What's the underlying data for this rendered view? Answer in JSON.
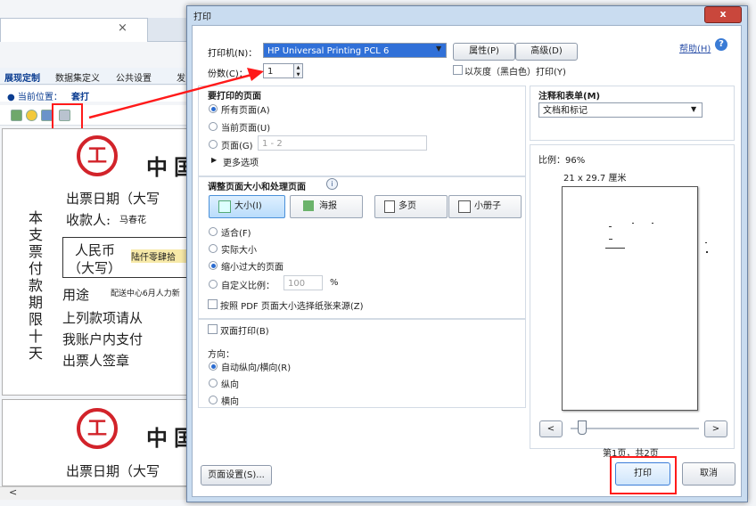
{
  "background_app": {
    "tab_close_glyph": "×",
    "menu": [
      "展现定制",
      "数据集定义",
      "公共设置",
      "发"
    ],
    "location_label": "● 当前位置：",
    "location_value": "套打",
    "cheque": {
      "logo_glyph": "工",
      "bank_char1": "中",
      "bank_char2": "国",
      "vertical_text": [
        "本",
        "支",
        "票",
        "付",
        "款",
        "期",
        "限",
        "十",
        "天"
      ],
      "issue_date": "出票日期（大写",
      "payee_label": "收款人:",
      "payee_value": "马春花",
      "rmb_label": "人民币",
      "rmb_sub": "（大写）",
      "amount_value": "陆仟零肆拾",
      "purpose_label": "用途",
      "purpose_value": "配送中心6月人力新",
      "line1": "上列款项请从",
      "line2": "我账户内支付",
      "line3": "出票人签章"
    },
    "scroll_left": "<"
  },
  "dialog": {
    "title": "打印",
    "close_glyph": "x",
    "printer_label": "打印机(N)：",
    "printer_value": "HP Universal Printing PCL 6",
    "properties_button": "属性(P)",
    "advanced_button": "高级(D)",
    "help_link": "帮助(H)",
    "help_icon": "?",
    "copies_label": "份数(C)：",
    "copies_value": "1",
    "grayscale_label": "以灰度（黑白色）打印(Y)",
    "pages_group": {
      "title": "要打印的页面",
      "all_pages": "所有页面(A)",
      "current_page": "当前页面(U)",
      "pages_option": "页面(G)",
      "pages_range": "1 - 2",
      "more_options": "更多选项"
    },
    "sizing_group": {
      "title": "调整页面大小和处理页面",
      "info_icon": "i",
      "size_button": "大小(I)",
      "poster_button": "海报",
      "multiple_button": "多页",
      "booklet_button": "小册子",
      "fit": "适合(F)",
      "actual_size": "实际大小",
      "shrink": "缩小过大的页面",
      "custom_scale": "自定义比例：",
      "custom_value": "100",
      "percent": "%",
      "pdf_paper_source": "按照 PDF 页面大小选择纸张来源(Z)"
    },
    "duplex": "双面打印(B)",
    "orientation": {
      "title": "方向：",
      "auto": "自动纵向/横向(R)",
      "portrait": "纵向",
      "landscape": "横向"
    },
    "comments_group": {
      "title": "注释和表单(M)",
      "value": "文档和标记"
    },
    "scale_text": "比例：96%",
    "paper_size": "21 x 29.7 厘米",
    "nav_prev": "<",
    "nav_next": ">",
    "page_indicator": "第1页，共2页",
    "page_setup_button": "页面设置(S)...",
    "print_button": "打印",
    "cancel_button": "取消"
  },
  "colors": {
    "annotation_red": "#ff1a1a",
    "bank_red": "#d2232a",
    "printer_highlight": "#3070d8",
    "dialog_frame": "#c9dcf0"
  }
}
